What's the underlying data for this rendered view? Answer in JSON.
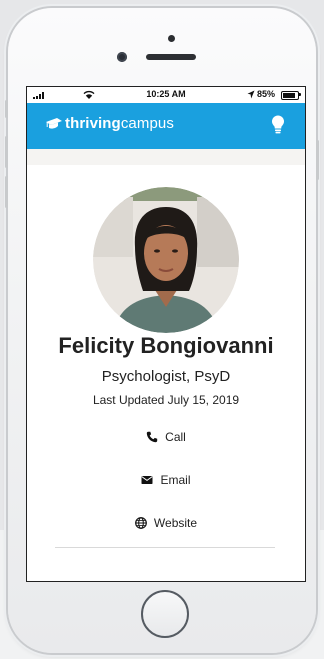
{
  "status_bar": {
    "time": "10:25 AM",
    "battery": "85%",
    "battery_level": 0.85
  },
  "app_bar": {
    "logo_part1": "thriving",
    "logo_part2": "campus",
    "logo_icon": "mortarboard-icon",
    "action_icon": "lightbulb-icon"
  },
  "profile": {
    "name": "Felicity Bongiovanni",
    "title": "Psychologist, PsyD",
    "last_updated": "Last Updated July 15, 2019"
  },
  "actions": [
    {
      "label": "Call",
      "icon": "phone-icon"
    },
    {
      "label": "Email",
      "icon": "envelope-icon"
    },
    {
      "label": "Website",
      "icon": "globe-icon"
    }
  ],
  "colors": {
    "brand": "#1aa0df",
    "text": "#222222"
  }
}
